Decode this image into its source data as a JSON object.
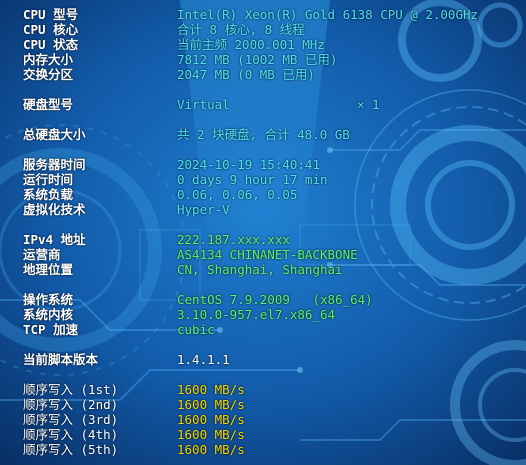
{
  "colors": {
    "background": "#0d3d78",
    "label": "#ffffff",
    "cyan": "#4fe0f0",
    "green": "#5ff06a",
    "white": "#ffffff",
    "yellow": "#f2d500"
  },
  "system": {
    "cpu_model": {
      "label": "CPU 型号",
      "value": "Intel(R) Xeon(R) Gold 6138 CPU @ 2.00GHz"
    },
    "cpu_cores": {
      "label": "CPU 核心",
      "value": "合计 8 核心, 8 线程"
    },
    "cpu_status": {
      "label": "CPU 状态",
      "value": "当前主频 2000.001 MHz"
    },
    "memory": {
      "label": "内存大小",
      "value": "7812 MB (1002 MB 已用)"
    },
    "swap": {
      "label": "交换分区",
      "value": "2047 MB (0 MB 已用)"
    }
  },
  "disk": {
    "model": {
      "label": "硬盘型号",
      "value": "Virtual",
      "count": "× 1"
    },
    "total": {
      "label": "总硬盘大小",
      "value": "共 2 块硬盘, 合计 48.0 GB"
    }
  },
  "runtime": {
    "server_time": {
      "label": "服务器时间",
      "value": "2024-10-19 15:40:41"
    },
    "uptime": {
      "label": "运行时间",
      "value": "0 days 9 hour 17 min"
    },
    "load": {
      "label": "系统负载",
      "value": "0.06, 0.06, 0.05"
    },
    "virt": {
      "label": "虚拟化技术",
      "value": "Hyper-V"
    }
  },
  "network": {
    "ipv4": {
      "label": "IPv4 地址",
      "value": "222.187.xxx.xxx"
    },
    "isp": {
      "label": "运营商",
      "value": "AS4134 CHINANET-BACKBONE"
    },
    "location": {
      "label": "地理位置",
      "value": "CN, Shanghai, Shanghai"
    }
  },
  "os": {
    "name": {
      "label": "操作系统",
      "value": "CentOS 7.9.2009   (x86_64)"
    },
    "kernel": {
      "label": "系统内核",
      "value": "3.10.0-957.el7.x86_64"
    },
    "tcp": {
      "label": "TCP 加速",
      "value": "cubic"
    }
  },
  "script": {
    "version": {
      "label": "当前脚本版本",
      "value": "1.4.1.1"
    }
  },
  "seq_write": [
    {
      "label": "顺序写入 (1st)",
      "value": "1600 MB/s"
    },
    {
      "label": "顺序写入 (2nd)",
      "value": "1600 MB/s"
    },
    {
      "label": "顺序写入 (3rd)",
      "value": "1600 MB/s"
    },
    {
      "label": "顺序写入 (4th)",
      "value": "1600 MB/s"
    },
    {
      "label": "顺序写入 (5th)",
      "value": "1600 MB/s"
    }
  ]
}
